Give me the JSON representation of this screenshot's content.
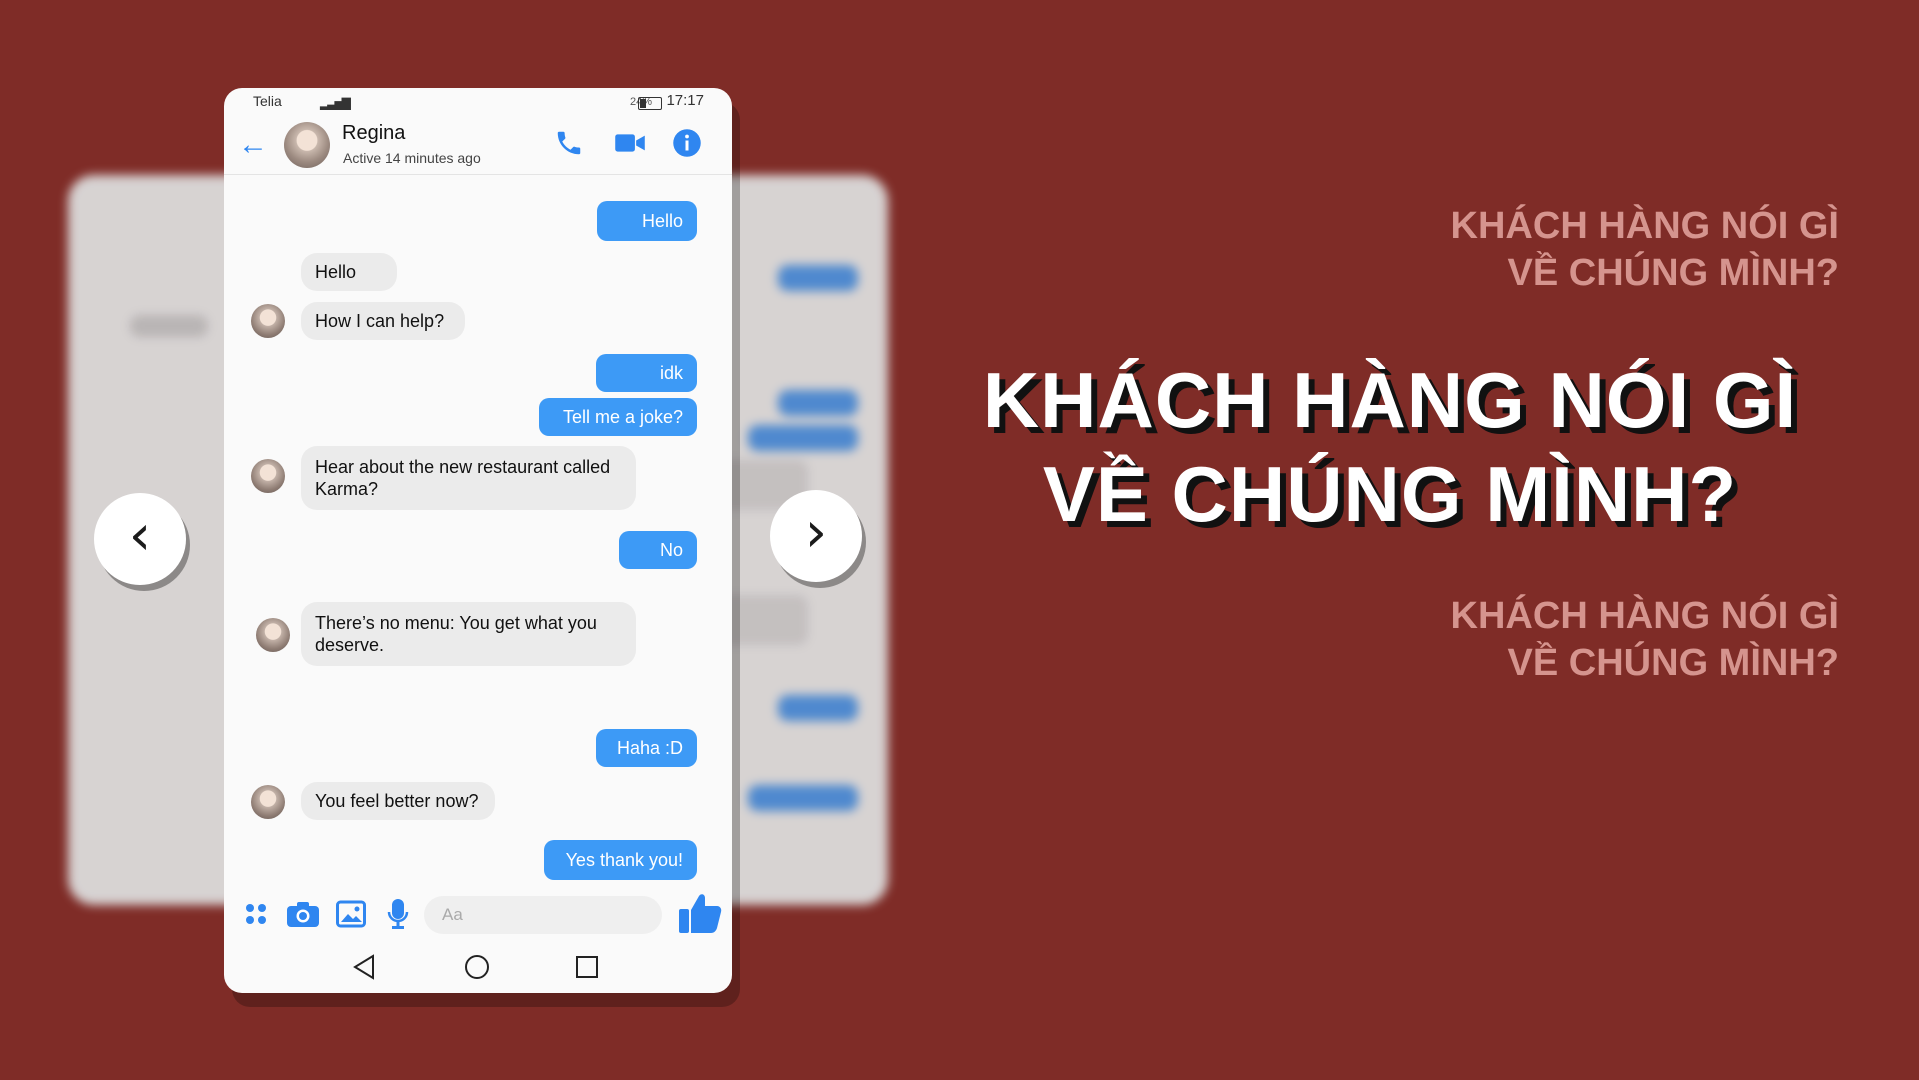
{
  "accent_color": "#3d9af6",
  "background_color": "#7f2c27",
  "status": {
    "carrier": "Telia",
    "battery": "24%",
    "clock": "17:17"
  },
  "contact": {
    "name": "Regina",
    "active": "Active 14 minutes ago"
  },
  "messages": [
    {
      "from": "me",
      "text": "Hello"
    },
    {
      "from": "them",
      "text": "Hello"
    },
    {
      "from": "them",
      "text": "How I can help?"
    },
    {
      "from": "me",
      "text": "idk"
    },
    {
      "from": "me",
      "text": "Tell me a joke?"
    },
    {
      "from": "them",
      "text": "Hear about the new restaurant called Karma?"
    },
    {
      "from": "me",
      "text": "No"
    },
    {
      "from": "them",
      "text": "There’s no menu: You get what you deserve."
    },
    {
      "from": "me",
      "text": "Haha :D"
    },
    {
      "from": "them",
      "text": "You feel better now?"
    },
    {
      "from": "me",
      "text": "Yes thank you!"
    }
  ],
  "composer": {
    "placeholder": "Aa"
  },
  "icons": {
    "back": "arrow-left-icon",
    "call": "phone-icon",
    "video": "video-camera-icon",
    "info": "info-icon",
    "apps": "apps-grid-icon",
    "camera": "camera-icon",
    "gallery": "image-icon",
    "mic": "microphone-icon",
    "like": "thumbs-up-icon",
    "nav_back": "triangle-back-icon",
    "nav_home": "circle-home-icon",
    "nav_recent": "square-recent-icon",
    "prev": "chevron-left-icon",
    "next": "chevron-right-icon"
  },
  "headline": {
    "line1": "KHÁCH HÀNG NÓI GÌ",
    "line2": "VỀ CHÚNG MÌNH?"
  },
  "echo_top": {
    "line1": "KHÁCH HÀNG NÓI GÌ",
    "line2": "VỀ CHÚNG MÌNH?"
  },
  "echo_bottom": {
    "line1": "KHÁCH HÀNG NÓI GÌ",
    "line2": "VỀ CHÚNG MÌNH?"
  }
}
